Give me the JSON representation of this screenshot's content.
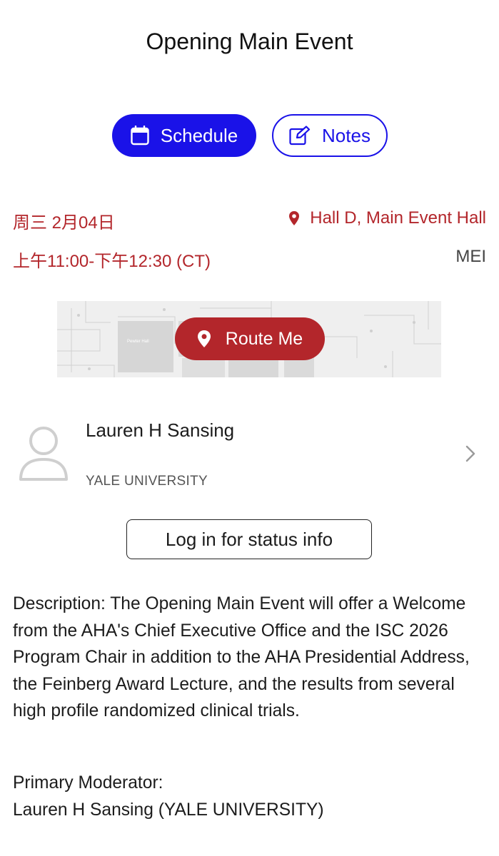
{
  "header": {
    "title": "Opening Main Event"
  },
  "actions": {
    "schedule_label": "Schedule",
    "notes_label": "Notes",
    "route_label": "Route Me",
    "login_label": "Log in for status info"
  },
  "session": {
    "date": "周三 2月04日",
    "time": "上午11:00-下午12:30 (CT)",
    "location": "Hall D, Main Event Hall",
    "code": "MEI"
  },
  "speaker": {
    "name": "Lauren H Sansing",
    "organization": "YALE UNIVERSITY"
  },
  "description": {
    "label": "Description:",
    "text": " The Opening Main Event will offer a Welcome from the AHA's Chief Executive Office and the ISC 2026 Program Chair in addition to the AHA Presidential Address, the Feinberg Award Lecture, and the results from several high profile randomized clinical trials."
  },
  "moderator": {
    "label": "Primary Moderator:",
    "value": "Lauren H Sansing (YALE UNIVERSITY)"
  },
  "map": {
    "hall_label": "Pewter Hall"
  },
  "icons": {
    "schedule": "calendar-icon",
    "notes": "edit-note-icon",
    "location": "map-pin-icon",
    "route": "map-pin-icon",
    "avatar": "person-placeholder-icon",
    "chevron": "chevron-right-icon"
  },
  "colors": {
    "primary_blue": "#1a12e8",
    "accent_red": "#b3262b"
  }
}
